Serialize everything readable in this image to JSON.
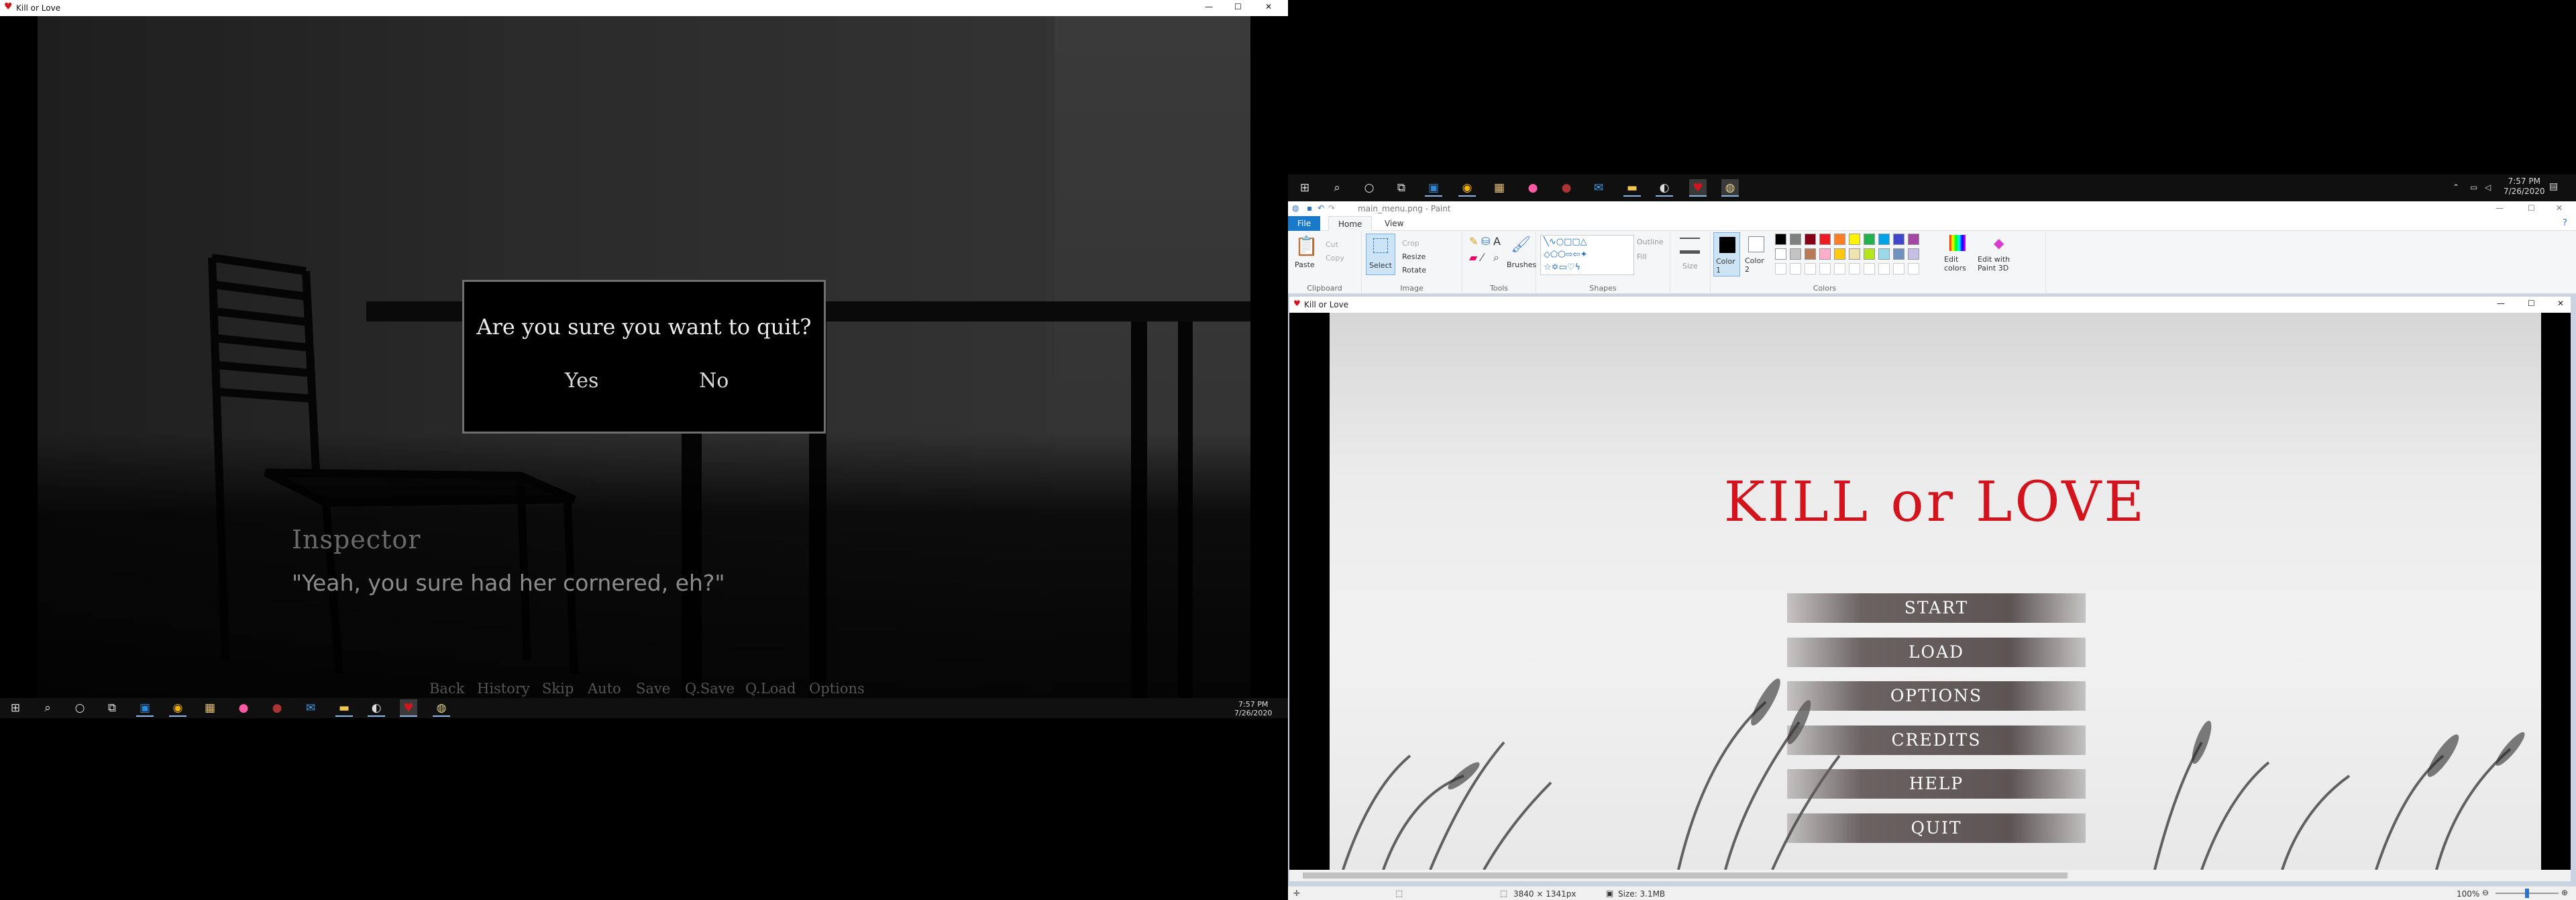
{
  "left_window": {
    "title": "Kill or Love",
    "controls": {
      "minimize": "—",
      "maximize": "☐",
      "close": "✕"
    },
    "dialogue": {
      "speaker": "Inspector",
      "text": "\"Yeah, you sure had her cornered, eh?\""
    },
    "quick_menu": [
      "Back",
      "History",
      "Skip",
      "Auto",
      "Save",
      "Q.Save",
      "Q.Load",
      "Options"
    ],
    "confirm": {
      "question": "Are you sure you want to quit?",
      "yes": "Yes",
      "no": "No"
    }
  },
  "taskbar_left": {
    "time": "7:57 PM",
    "date": "7/26/2020"
  },
  "taskbar_right": {
    "time": "7:57 PM",
    "date": "7/26/2020"
  },
  "paint": {
    "title": "main_menu.png - Paint",
    "tabs": [
      "File",
      "Home",
      "View"
    ],
    "clipboard": {
      "paste": "Paste",
      "cut": "Cut",
      "copy": "Copy",
      "label": "Clipboard"
    },
    "image": {
      "select": "Select",
      "crop": "Crop",
      "resize": "Resize",
      "rotate": "Rotate",
      "label": "Image"
    },
    "tools": {
      "label": "Tools",
      "brushes": "Brushes"
    },
    "shapes": {
      "outline": "Outline",
      "fill": "Fill",
      "label": "Shapes"
    },
    "size": "Size",
    "colors": {
      "color1": "Color 1",
      "color2": "Color 2",
      "edit": "Edit colors",
      "paint3d": "Edit with Paint 3D",
      "label": "Colors"
    },
    "palette": [
      "#000000",
      "#7f7f7f",
      "#880015",
      "#ed1c24",
      "#ff7f27",
      "#fff200",
      "#22b14c",
      "#00a2e8",
      "#3f48cc",
      "#a349a4",
      "#ffffff",
      "#c3c3c3",
      "#b97a57",
      "#ffaec9",
      "#ffc90e",
      "#efe4b0",
      "#b5e61d",
      "#99d9ea",
      "#7092be",
      "#c8bfe7"
    ],
    "status": {
      "dimensions": "3840 × 1341px",
      "size": "Size: 3.1MB",
      "zoom": "100%"
    }
  },
  "inner_window": {
    "title": "Kill or Love"
  },
  "main_menu": {
    "title": "KILL or LOVE",
    "buttons": [
      "START",
      "LOAD",
      "OPTIONS",
      "CREDITS",
      "HELP",
      "QUIT"
    ]
  }
}
